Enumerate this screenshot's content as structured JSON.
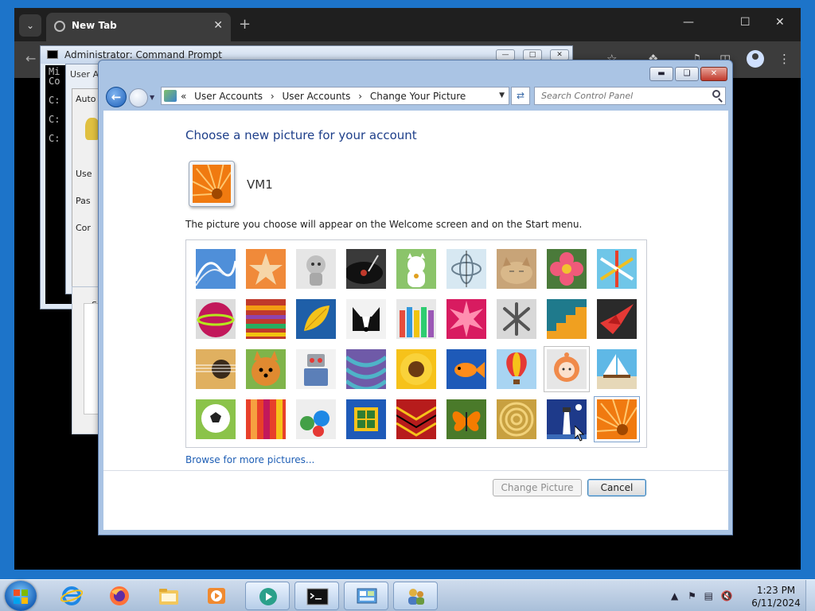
{
  "browser": {
    "tab_title": "New Tab"
  },
  "cmd": {
    "title": "Administrator: Command Prompt",
    "lines": [
      "Mi",
      "Co",
      "",
      "C:",
      "",
      "C:",
      "",
      "C:"
    ]
  },
  "user_accounts_bg": {
    "title": "User A",
    "panel_tab": "Auto",
    "labels": [
      "Use",
      "Pas",
      "Cor"
    ],
    "group": "Se"
  },
  "window": {
    "breadcrumbs": [
      "User Accounts",
      "User Accounts",
      "Change Your Picture"
    ],
    "search_placeholder": "Search Control Panel",
    "heading": "Choose a new picture for your account",
    "username": "VM1",
    "description": "The picture you choose will appear on the Welcome screen and on the Start menu.",
    "browse_link": "Browse for more pictures...",
    "buttons": {
      "change": "Change Picture",
      "cancel": "Cancel"
    },
    "pictures": [
      "roller-coaster",
      "starfish",
      "robot-figure",
      "turntable",
      "lucky-cat",
      "gyroscope",
      "kitten",
      "pink-flower",
      "pinwheel",
      "bowling-ball",
      "fabric-stripes",
      "leaf",
      "border-collie",
      "crayons",
      "pink-star-flower",
      "jacks",
      "stairs",
      "paper-crane",
      "guitar",
      "pomeranian",
      "toy-robot",
      "yarn",
      "sunflower",
      "fish",
      "hot-air-balloon",
      "doll",
      "sailboat",
      "soccer-ball",
      "silk-fabric",
      "marbles",
      "window-frame",
      "textile",
      "butterfly",
      "basket",
      "lighthouse",
      "orange-flower"
    ],
    "selected_picture": "orange-flower",
    "hovered_picture": "doll"
  },
  "taskbar": {
    "time": "1:23 PM",
    "date": "6/11/2024",
    "items": [
      "internet-explorer",
      "firefox",
      "file-explorer",
      "media-player",
      "app-circle",
      "command-prompt",
      "control-panel",
      "user-accounts"
    ]
  }
}
